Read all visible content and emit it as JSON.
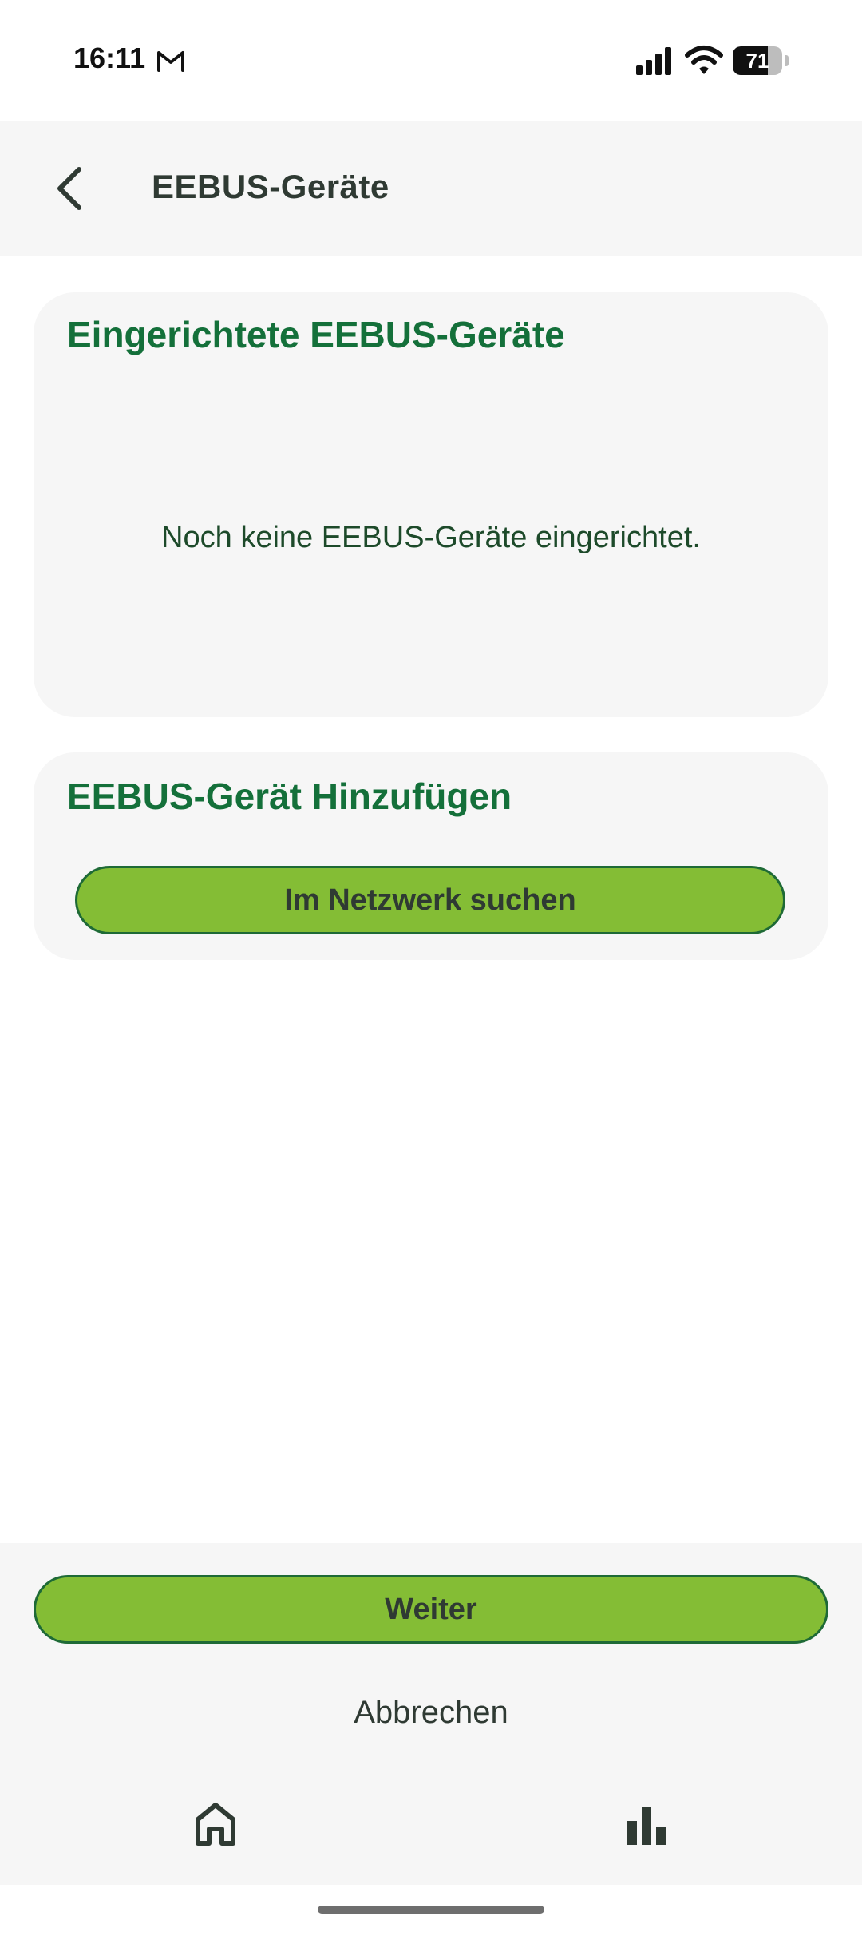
{
  "status_bar": {
    "time": "16:11",
    "battery_level": "71",
    "battery_fraction": 0.71
  },
  "app_bar": {
    "title": "EEBUS-Geräte",
    "back_icon": "chevron-left-icon"
  },
  "configured_devices": {
    "title": "Eingerichtete EEBUS-Geräte",
    "empty_message": "Noch keine EEBUS-Geräte eingerichtet."
  },
  "add_device": {
    "title": "EEBUS-Gerät Hinzufügen",
    "search_button": "Im Netzwerk suchen"
  },
  "footer": {
    "next_button": "Weiter",
    "cancel_button": "Abbrechen"
  },
  "bottom_nav": {
    "items": [
      {
        "icon": "home-icon"
      },
      {
        "icon": "bar-chart-icon"
      }
    ]
  },
  "colors": {
    "accent_green": "#84bd35",
    "title_green": "#14703a",
    "border_green": "#1e6a36"
  }
}
